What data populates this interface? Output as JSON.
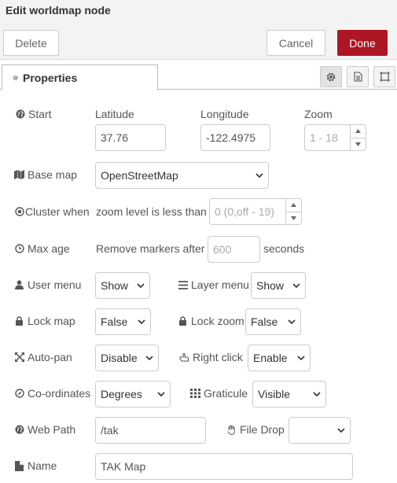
{
  "header": {
    "title": "Edit worldmap node",
    "delete_label": "Delete",
    "cancel_label": "Cancel",
    "done_label": "Done"
  },
  "tabs": {
    "properties_label": "Properties",
    "icons": [
      "gear-icon",
      "document-icon",
      "frame-icon"
    ]
  },
  "form": {
    "start": {
      "label": "Start",
      "latitude_label": "Latitude",
      "latitude_value": "37.76",
      "longitude_label": "Longitude",
      "longitude_value": "-122.4975",
      "zoom_label": "Zoom",
      "zoom_placeholder": "1 - 18"
    },
    "base_map": {
      "label": "Base map",
      "value": "OpenStreetMap"
    },
    "cluster": {
      "label": "Cluster when",
      "text": "zoom level is less than",
      "placeholder": "0 (0,off - 19)"
    },
    "max_age": {
      "label": "Max age",
      "text": "Remove markers after",
      "placeholder": "600",
      "unit": "seconds"
    },
    "user_menu": {
      "label": "User menu",
      "value": "Show"
    },
    "layer_menu": {
      "label": "Layer menu",
      "value": "Show"
    },
    "lock_map": {
      "label": "Lock map",
      "value": "False"
    },
    "lock_zoom": {
      "label": "Lock zoom",
      "value": "False"
    },
    "auto_pan": {
      "label": "Auto-pan",
      "value": "Disable"
    },
    "right_click": {
      "label": "Right click",
      "value": "Enable"
    },
    "coordinates": {
      "label": "Co-ordinates",
      "value": "Degrees"
    },
    "graticule": {
      "label": "Graticule",
      "value": "Visible"
    },
    "web_path": {
      "label": "Web Path",
      "value": "/tak"
    },
    "file_drop": {
      "label": "File Drop",
      "value": ""
    },
    "name": {
      "label": "Name",
      "value": "TAK Map"
    }
  },
  "colors": {
    "primary": "#ad1625",
    "header_bg": "#f3f3f3",
    "border": "#cccccc"
  }
}
